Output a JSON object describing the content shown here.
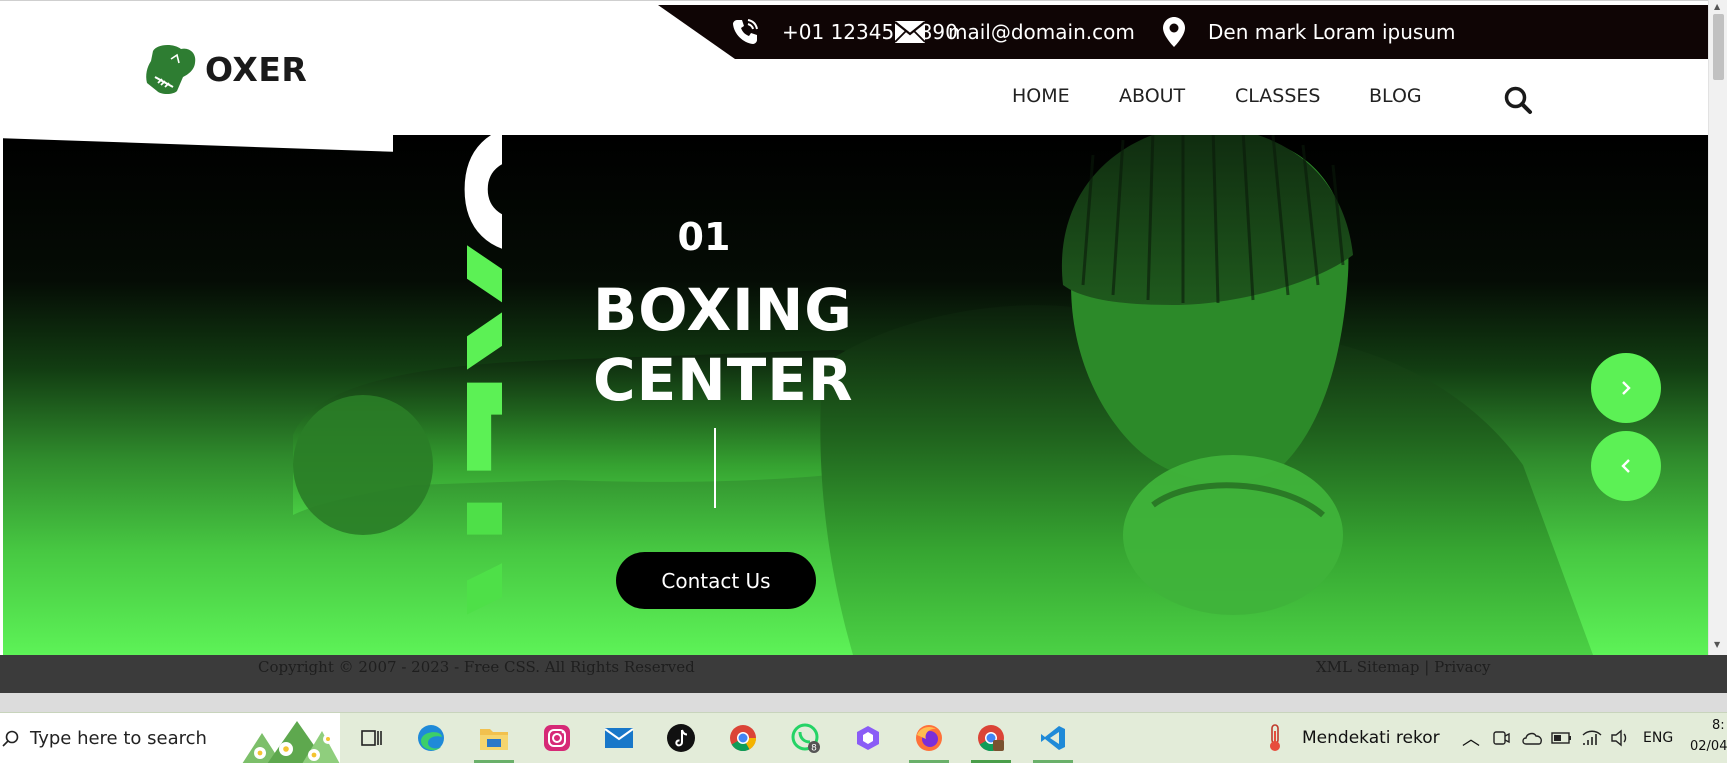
{
  "topbar": {
    "phone": "+01 1234567890",
    "email": "mail@domain.com",
    "location": "Den mark Loram ipusum"
  },
  "logo": {
    "text": "OXER",
    "icon": "boxing-glove-icon"
  },
  "nav": {
    "items": [
      {
        "label": "HOME"
      },
      {
        "label": "ABOUT"
      },
      {
        "label": "CLASSES"
      },
      {
        "label": "BLOG"
      }
    ],
    "search_icon": "search-icon"
  },
  "hero": {
    "vertical_word": "OXER",
    "slide_number": "01",
    "title_line1": "BOXING",
    "title_line2": "CENTER",
    "cta_label": "Contact Us",
    "next_icon": "chevron-right-icon",
    "prev_icon": "chevron-left-icon"
  },
  "footer": {
    "copyright": "Copyright © 2007 - 2023 - Free CSS. All Rights Reserved",
    "links": "XML Sitemap | Privacy"
  },
  "taskbar": {
    "search_placeholder": "Type here to search",
    "weather_text": "Mendekati rekor",
    "language": "ENG",
    "time": "8:",
    "date": "02/04",
    "whatsapp_badge": "8"
  },
  "colors": {
    "accent_green": "#5cf155",
    "topbar_bg": "#0f0505",
    "footer_bg": "#3b3b3b"
  }
}
